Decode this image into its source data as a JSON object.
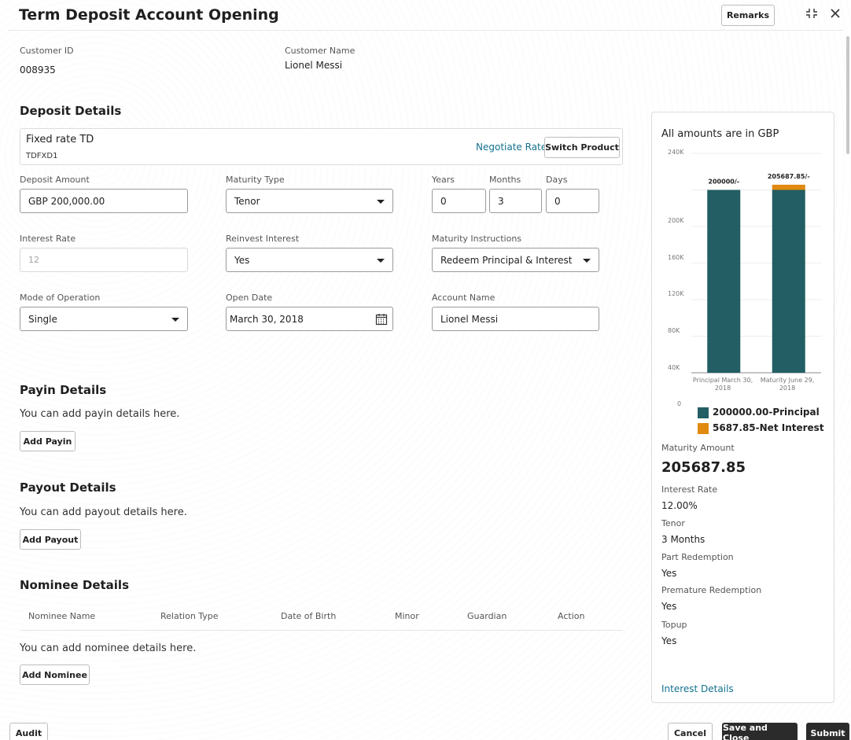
{
  "header": {
    "title": "Term Deposit Account Opening",
    "remarks_label": "Remarks"
  },
  "customer": {
    "id_label": "Customer ID",
    "id_value": "008935",
    "name_label": "Customer Name",
    "name_value": "Lionel Messi"
  },
  "deposit": {
    "section_title": "Deposit Details",
    "product_name": "Fixed rate TD",
    "product_code": "TDFXD1",
    "negotiate_label": "Negotiate Rate",
    "switch_label": "Switch Product",
    "amount_label": "Deposit Amount",
    "amount_value": "GBP 200,000.00",
    "maturity_type_label": "Maturity Type",
    "maturity_type_value": "Tenor",
    "years_label": "Years",
    "years_value": "0",
    "months_label": "Months",
    "months_value": "3",
    "days_label": "Days",
    "days_value": "0",
    "interest_rate_label": "Interest Rate",
    "interest_rate_value": "12",
    "reinvest_label": "Reinvest Interest",
    "reinvest_value": "Yes",
    "maturity_instr_label": "Maturity Instructions",
    "maturity_instr_value": "Redeem Principal & Interest",
    "mode_label": "Mode of Operation",
    "mode_value": "Single",
    "open_date_label": "Open Date",
    "open_date_value": "March 30, 2018",
    "account_name_label": "Account Name",
    "account_name_value": "Lionel Messi"
  },
  "payin": {
    "title": "Payin Details",
    "hint": "You can add payin details here.",
    "button": "Add Payin"
  },
  "payout": {
    "title": "Payout Details",
    "hint": "You can add payout details here.",
    "button": "Add Payout"
  },
  "nominee": {
    "title": "Nominee Details",
    "columns": [
      "Nominee Name",
      "Relation Type",
      "Date of Birth",
      "Minor",
      "Guardian",
      "Action"
    ],
    "hint": "You can add nominee details here.",
    "button": "Add Nominee"
  },
  "summary": {
    "currency_note": "All amounts are in GBP",
    "legend_principal": "200000.00-Principal",
    "legend_interest": "5687.85-Net Interest",
    "maturity_amount_label": "Maturity Amount",
    "maturity_amount_value": "205687.85",
    "interest_rate_label": "Interest Rate",
    "interest_rate_value": "12.00%",
    "tenor_label": "Tenor",
    "tenor_value": "3 Months",
    "part_redemption_label": "Part Redemption",
    "part_redemption_value": "Yes",
    "premature_label": "Premature Redemption",
    "premature_value": "Yes",
    "topup_label": "Topup",
    "topup_value": "Yes",
    "interest_details_link": "Interest Details"
  },
  "chart_data": {
    "type": "bar",
    "stacked": true,
    "categories": [
      "Principal March 30, 2018",
      "Maturity June 29, 2018"
    ],
    "series": [
      {
        "name": "200000.00-Principal",
        "values": [
          200000,
          200000
        ],
        "color": "#225e63"
      },
      {
        "name": "5687.85-Net Interest",
        "values": [
          0,
          5687.85
        ],
        "color": "#e08a10"
      }
    ],
    "bar_labels": [
      "200000/-",
      "205687.85/-"
    ],
    "ylim": [
      0,
      240000
    ],
    "yticks": [
      "0",
      "40K",
      "80K",
      "120K",
      "160K",
      "200K",
      "240K"
    ],
    "grid": true
  },
  "footer": {
    "audit": "Audit",
    "cancel": "Cancel",
    "save_close": "Save and Close",
    "submit": "Submit"
  }
}
